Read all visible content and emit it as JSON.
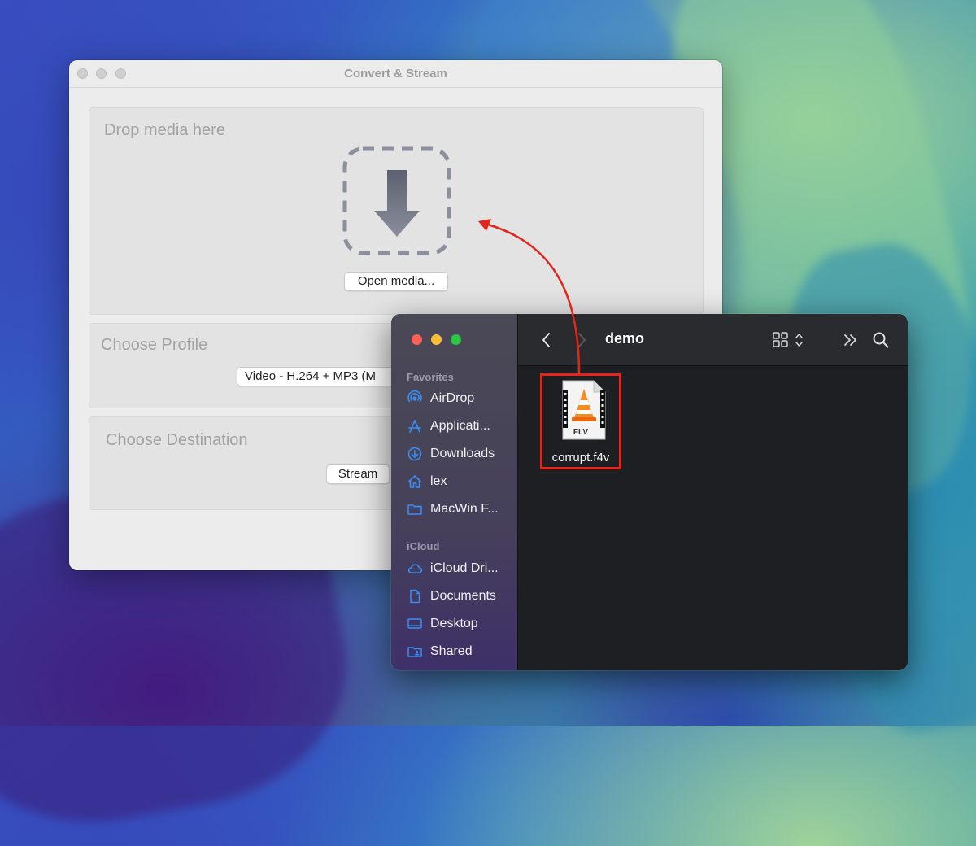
{
  "convert_window": {
    "title": "Convert & Stream",
    "drop_panel": {
      "title": "Drop media here",
      "open_button": "Open media..."
    },
    "profile_panel": {
      "title": "Choose Profile",
      "profile_select": "Video - H.264 + MP3 (M"
    },
    "destination_panel": {
      "title": "Choose Destination",
      "stream_button": "Stream"
    }
  },
  "finder": {
    "folder_title": "demo",
    "sidebar": {
      "favorites_header": "Favorites",
      "favorites": [
        {
          "label": "AirDrop",
          "icon": "airdrop-icon"
        },
        {
          "label": "Applicati...",
          "icon": "applications-icon"
        },
        {
          "label": "Downloads",
          "icon": "downloads-icon"
        },
        {
          "label": "lex",
          "icon": "home-icon"
        },
        {
          "label": "MacWin F...",
          "icon": "folder-icon"
        }
      ],
      "icloud_header": "iCloud",
      "icloud": [
        {
          "label": "iCloud Dri...",
          "icon": "icloud-icon"
        },
        {
          "label": "Documents",
          "icon": "document-icon"
        },
        {
          "label": "Desktop",
          "icon": "desktop-icon"
        },
        {
          "label": "Shared",
          "icon": "shared-folder-icon"
        }
      ]
    },
    "file": {
      "name": "corrupt.f4v",
      "badge": "FLV"
    }
  },
  "colors": {
    "accent_blue": "#3a8ef6",
    "highlight_red": "#e2261b"
  }
}
